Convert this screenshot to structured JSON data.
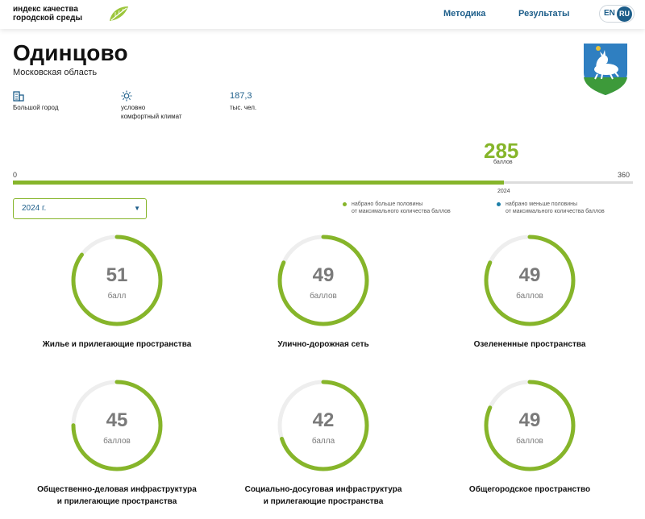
{
  "header": {
    "logo_line1": "индекс качества",
    "logo_line2": "городской среды",
    "nav": [
      "Методика",
      "Результаты"
    ],
    "lang_en": "EN",
    "lang_ru": "RU"
  },
  "city": {
    "name": "Одинцово",
    "region": "Московская область"
  },
  "info": {
    "city_type": "Большой город",
    "climate_line1": "условно",
    "climate_line2": "комфортный климат",
    "population_value": "187,3",
    "population_unit": "тыс. чел."
  },
  "score": {
    "value": 285,
    "unit": "баллов",
    "min": 0,
    "max": 360,
    "min_label": "0",
    "max_label": "360",
    "year": "2024",
    "fill_fraction": 0.7917
  },
  "year_select": {
    "selected": "2024 г."
  },
  "legend": [
    {
      "line1": "набрано больше половины",
      "line2": "от максимального количества баллов",
      "color": "#86b52a"
    },
    {
      "line1": "набрано меньше половины",
      "line2": "от максимального количества баллов",
      "color": "#1d7fa8"
    }
  ],
  "categories": [
    {
      "score": 51,
      "unit": "балл",
      "label_line1": "Жилье и прилегающие пространства",
      "label_line2": ""
    },
    {
      "score": 49,
      "unit": "баллов",
      "label_line1": "Улично-дорожная сеть",
      "label_line2": ""
    },
    {
      "score": 49,
      "unit": "баллов",
      "label_line1": "Озелененные пространства",
      "label_line2": ""
    },
    {
      "score": 45,
      "unit": "баллов",
      "label_line1": "Общественно-деловая инфраструктура",
      "label_line2": "и прилегающие пространства"
    },
    {
      "score": 42,
      "unit": "балла",
      "label_line1": "Социально-досуговая инфраструктура",
      "label_line2": "и прилегающие пространства"
    },
    {
      "score": 49,
      "unit": "баллов",
      "label_line1": "Общегородское пространство",
      "label_line2": ""
    }
  ],
  "category_max": 60,
  "colors": {
    "accent": "#86b52a",
    "link": "#1d5e8a",
    "track": "#eeeeee"
  }
}
